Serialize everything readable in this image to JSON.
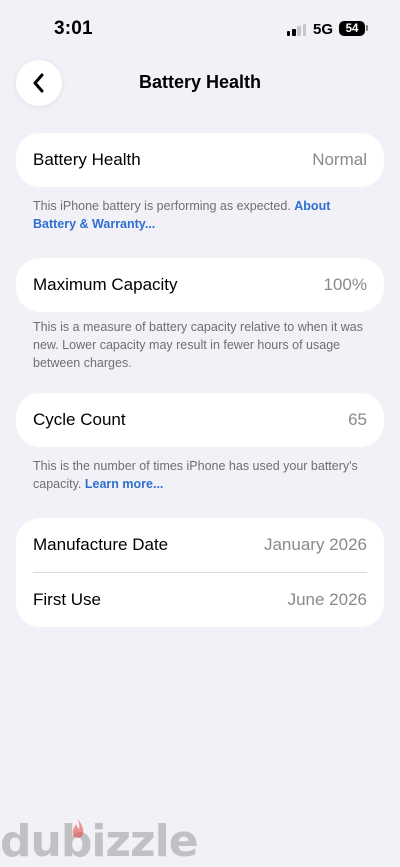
{
  "status_bar": {
    "time": "3:01",
    "network": "5G",
    "battery_level": "54",
    "signal_bars_filled": 2,
    "signal_bars_total": 4
  },
  "header": {
    "title": "Battery Health",
    "back_icon": "chevron-left-icon"
  },
  "battery_health": {
    "label": "Battery Health",
    "value": "Normal",
    "note": "This iPhone battery is performing as expected.",
    "note_link": "About Battery & Warranty..."
  },
  "maximum_capacity": {
    "label": "Maximum Capacity",
    "value": "100%",
    "note": "This is a measure of battery capacity relative to when it was new. Lower capacity may result in fewer hours of usage between charges."
  },
  "cycle_count": {
    "label": "Cycle Count",
    "value": "65",
    "note": "This is the number of times iPhone has used your battery's capacity.",
    "note_link": "Learn more..."
  },
  "dates": {
    "manufacture_label": "Manufacture Date",
    "manufacture_value": "January 2026",
    "first_use_label": "First Use",
    "first_use_value": "June 2026"
  },
  "watermark": {
    "text": "dubizzle"
  },
  "colors": {
    "background": "#f2f1f7",
    "card": "#ffffff",
    "link": "#2e6fcf",
    "secondary_text": "#8a8a8e"
  }
}
